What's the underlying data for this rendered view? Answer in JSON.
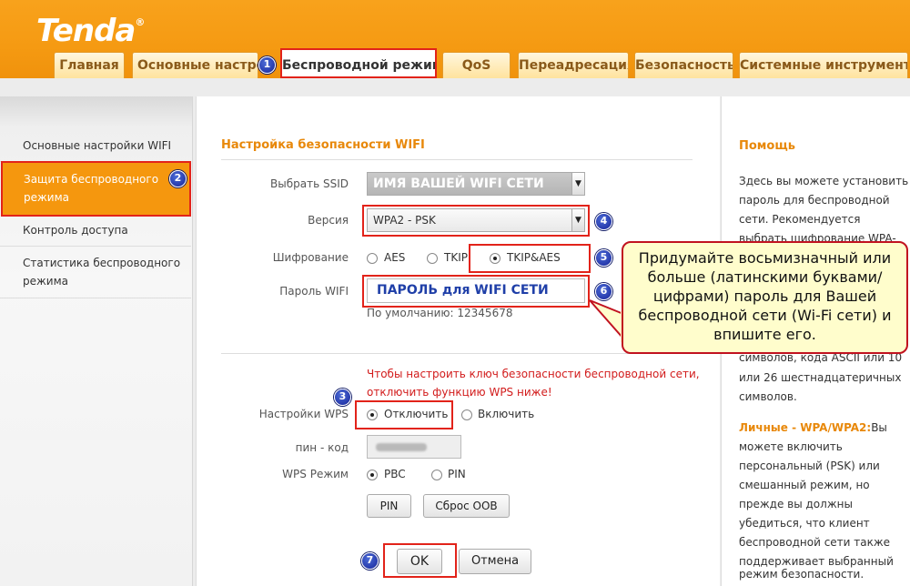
{
  "brand": {
    "logo": "Tenda",
    "reg": "®"
  },
  "tabs": [
    "Главная",
    "Основные настрой",
    "Беспроводной режим",
    "QoS",
    "Переадресация",
    "Безопасность",
    "Системные инструменты"
  ],
  "sidebar": {
    "items": [
      {
        "lines": [
          "Основные настройки WIFI"
        ]
      },
      {
        "lines": [
          "Защита беспроводного",
          "режима"
        ]
      },
      {
        "lines": [
          "Контроль доступа"
        ]
      },
      {
        "lines": [
          "Статистика беспроводного",
          "режима"
        ]
      }
    ]
  },
  "form": {
    "title": "Настройка безопасности WIFI",
    "ssid_label": "Выбрать SSID",
    "ssid_value": "ИМЯ ВАШЕЙ WIFI СЕТИ",
    "version_label": "Версия",
    "version_value": "WPA2 - PSK",
    "cipher_label": "Шифрование",
    "cipher_options": [
      "AES",
      "TKIP",
      "TKIP&AES"
    ],
    "password_label": "Пароль WIFI",
    "password_value": "ПАРОЛЬ для WIFI СЕТИ",
    "password_default": "По умолчанию: 12345678",
    "wps_warning": [
      "Чтобы настроить ключ безопасности беспроводной сети,",
      "отключить функцию WPS ниже!"
    ],
    "wps_label": "Настройки WPS",
    "wps_options": [
      "Отключить",
      "Включить"
    ],
    "pin_label": "пин - код",
    "wps_mode_label": "WPS Режим",
    "wps_mode_options": [
      "PBC",
      "PIN"
    ],
    "pin_button": "PIN",
    "reset_oob_button": "Сброс OOB",
    "ok_button": "OK",
    "cancel_button": "Отмена"
  },
  "badges": [
    "1",
    "2",
    "3",
    "4",
    "5",
    "6",
    "7"
  ],
  "callout": {
    "text": "Придумайте восьмизначный или больше (латинскими буквами/цифрами) пароль для Вашей беспроводной сети (Wi-Fi сети) и впишите его."
  },
  "help": {
    "title": "Помощь",
    "lines": [
      "Здесь вы можете установить",
      "пароль для беспроводной",
      "сети. Рекомендуется",
      "выбрать шифрование WPA-"
    ],
    "lines2": [
      "символов, кода ASCII или 10",
      "или 26 шестнадцатеричных",
      "символов."
    ],
    "personal_title": "Личные - WPA/WPA2:",
    "personal_first": "Вы",
    "lines3": [
      "можете включить",
      "персональный (PSK) или",
      "смешанный режим, но",
      "прежде вы должны",
      "убедиться, что клиент",
      "беспроводной сети также",
      "поддерживает выбранный",
      "режим безопасности."
    ]
  },
  "colors": {
    "accent": "#f59a12",
    "highlight": "#e2231a",
    "section_title": "#e8880a",
    "badge": "#17259a"
  }
}
